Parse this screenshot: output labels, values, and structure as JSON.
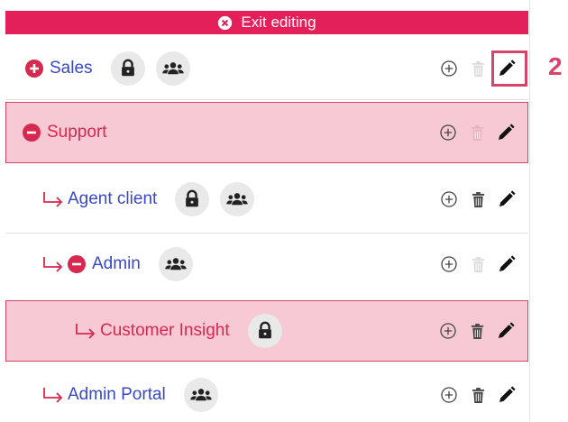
{
  "exit_bar": {
    "label": "Exit editing",
    "icon": "close-circle-icon"
  },
  "colors": {
    "accent": "#e3205a",
    "link": "#3848c8",
    "highlight_bg": "#f7c9d4",
    "highlight_border": "#d5456a"
  },
  "rows": [
    {
      "label": "Sales",
      "toggle": "plus",
      "badges": [
        "lock-icon",
        "users-icon"
      ],
      "delete_enabled": false,
      "highlighted": false
    },
    {
      "label": "Support",
      "toggle": "minus",
      "badges": [],
      "delete_enabled": false,
      "highlighted": true
    },
    {
      "label": "Agent client",
      "indent": 1,
      "badges": [
        "lock-icon",
        "users-icon"
      ],
      "delete_enabled": true,
      "highlighted": false
    },
    {
      "label": "Admin",
      "indent": 1,
      "toggle": "minus",
      "badges": [
        "users-icon"
      ],
      "delete_enabled": false,
      "highlighted": false
    },
    {
      "label": "Customer Insight",
      "indent": 2,
      "badges": [
        "lock-icon"
      ],
      "delete_enabled": true,
      "highlighted": true
    },
    {
      "label": "Admin Portal",
      "indent": 1,
      "badges": [
        "users-icon"
      ],
      "delete_enabled": true,
      "highlighted": false
    }
  ],
  "annotation": {
    "step": "2"
  }
}
